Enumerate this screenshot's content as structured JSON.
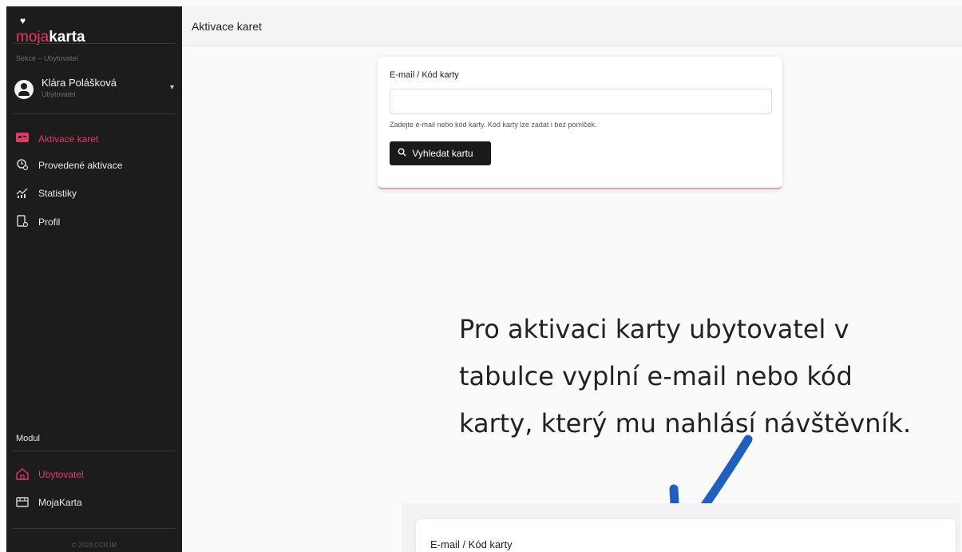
{
  "brand": {
    "part1": "moja",
    "part2": "karta",
    "heart": "♥"
  },
  "sidebar": {
    "section_label": "Sekce – Ubytovatel",
    "user": {
      "name": "Klára Polášková",
      "role": "Ubytovatel"
    },
    "items": [
      {
        "label": "Aktivace karet",
        "icon": "card-icon"
      },
      {
        "label": "Provedené aktivace",
        "icon": "history-icon"
      },
      {
        "label": "Statistiky",
        "icon": "chart-icon"
      },
      {
        "label": "Profil",
        "icon": "profile-icon"
      }
    ],
    "module_label": "Modul",
    "modules": [
      {
        "label": "Ubytovatel",
        "icon": "house-icon"
      },
      {
        "label": "MojaKarta",
        "icon": "store-icon"
      }
    ],
    "footer": "© 2024 CCRJM"
  },
  "topbar": {
    "title": "Aktivace karet"
  },
  "form": {
    "label": "E-mail / Kód karty",
    "value": "",
    "help": "Zadejte e-mail nebo kód karty. Kód karty lze zadat i bez pomlček.",
    "button": "Vyhledat kartu"
  },
  "annotation": {
    "line1": "Pro aktivaci karty ubytovatel v",
    "line2": "tabulce vyplní e-mail nebo kód",
    "line3": "karty, který mu nahlásí návštěvník."
  },
  "preview": {
    "label": "E-mail / Kód karty"
  },
  "colors": {
    "accent": "#e23a63",
    "sidebar": "#1c1c1c",
    "arrow": "#1f5fbf"
  }
}
